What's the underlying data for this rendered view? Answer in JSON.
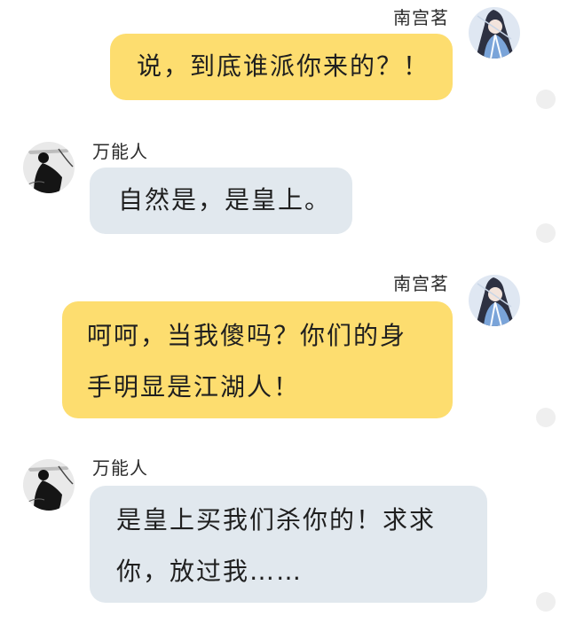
{
  "messages": [
    {
      "sender": "南宫茗",
      "side": "right",
      "lines": [
        "说，到底谁派你来的？！"
      ]
    },
    {
      "sender": "万能人",
      "side": "left",
      "lines": [
        "自然是，是皇上。"
      ]
    },
    {
      "sender": "南宫茗",
      "side": "right",
      "lines": [
        "呵呵，当我傻吗？你们的身",
        "手明显是江湖人！"
      ]
    },
    {
      "sender": "万能人",
      "side": "left",
      "lines": [
        "是皇上买我们杀你的！求求",
        "你，放过我……"
      ]
    }
  ],
  "icons": {
    "right_avatar": "swordsman-avatar-icon",
    "left_avatar": "ink-figure-avatar-icon",
    "status_dot": "status-dot-icon"
  },
  "colors": {
    "right_bubble": "#fddd6f",
    "left_bubble": "#e1e8ee",
    "name_text": "#2b2b2b"
  }
}
